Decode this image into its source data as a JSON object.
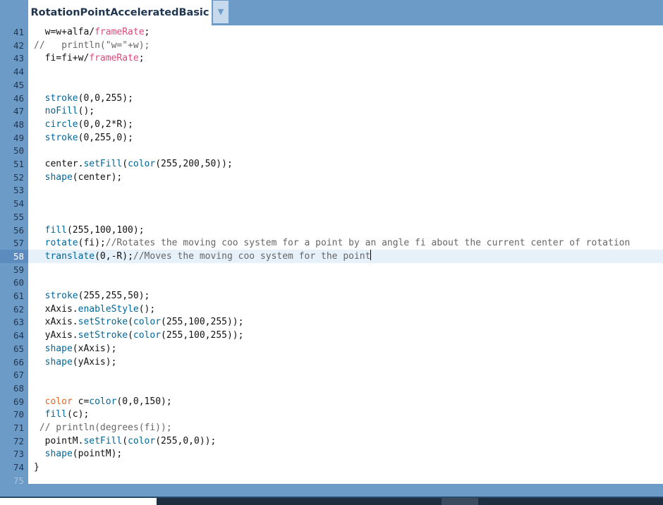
{
  "tab": {
    "title": "RotationPointAcceleratedBasic",
    "menu_arrow": "▼"
  },
  "current_line": 58,
  "lines": [
    {
      "n": "41",
      "t": [
        {
          "x": "  w=w+alfa/"
        },
        {
          "x": "frameRate",
          "c": "va"
        },
        {
          "x": ";"
        }
      ]
    },
    {
      "n": "42",
      "t": [
        {
          "x": "//   println(\"w=\"+w);",
          "c": "cm"
        }
      ]
    },
    {
      "n": "43",
      "t": [
        {
          "x": "  fi=fi+w/"
        },
        {
          "x": "frameRate",
          "c": "va"
        },
        {
          "x": ";"
        }
      ]
    },
    {
      "n": "44",
      "t": []
    },
    {
      "n": "45",
      "t": []
    },
    {
      "n": "46",
      "t": [
        {
          "x": "  "
        },
        {
          "x": "stroke",
          "c": "fn"
        },
        {
          "x": "(0,0,255);"
        }
      ]
    },
    {
      "n": "47",
      "t": [
        {
          "x": "  "
        },
        {
          "x": "noFill",
          "c": "fn"
        },
        {
          "x": "();"
        }
      ]
    },
    {
      "n": "48",
      "t": [
        {
          "x": "  "
        },
        {
          "x": "circle",
          "c": "fn"
        },
        {
          "x": "(0,0,2*R);"
        }
      ]
    },
    {
      "n": "49",
      "t": [
        {
          "x": "  "
        },
        {
          "x": "stroke",
          "c": "fn"
        },
        {
          "x": "(0,255,0);"
        }
      ]
    },
    {
      "n": "50",
      "t": []
    },
    {
      "n": "51",
      "t": [
        {
          "x": "  center."
        },
        {
          "x": "setFill",
          "c": "fn"
        },
        {
          "x": "("
        },
        {
          "x": "color",
          "c": "fn"
        },
        {
          "x": "(255,200,50));"
        }
      ]
    },
    {
      "n": "52",
      "t": [
        {
          "x": "  "
        },
        {
          "x": "shape",
          "c": "fn"
        },
        {
          "x": "(center);"
        }
      ]
    },
    {
      "n": "53",
      "t": []
    },
    {
      "n": "54",
      "t": []
    },
    {
      "n": "55",
      "t": []
    },
    {
      "n": "56",
      "t": [
        {
          "x": "  "
        },
        {
          "x": "fill",
          "c": "fn"
        },
        {
          "x": "(255,100,100);"
        }
      ]
    },
    {
      "n": "57",
      "t": [
        {
          "x": "  "
        },
        {
          "x": "rotate",
          "c": "fn"
        },
        {
          "x": "(fi);"
        },
        {
          "x": "//Rotates the moving coo system for a point by an angle fi about the current center of rotation",
          "c": "cm"
        }
      ]
    },
    {
      "n": "58",
      "t": [
        {
          "x": "  "
        },
        {
          "x": "translate",
          "c": "fn"
        },
        {
          "x": "(0,-R);"
        },
        {
          "x": "//Moves the moving coo system for the point",
          "c": "cm"
        }
      ]
    },
    {
      "n": "59",
      "t": []
    },
    {
      "n": "60",
      "t": []
    },
    {
      "n": "61",
      "t": [
        {
          "x": "  "
        },
        {
          "x": "stroke",
          "c": "fn"
        },
        {
          "x": "(255,255,50);"
        }
      ]
    },
    {
      "n": "62",
      "t": [
        {
          "x": "  xAxis."
        },
        {
          "x": "enableStyle",
          "c": "fn"
        },
        {
          "x": "();"
        }
      ]
    },
    {
      "n": "63",
      "t": [
        {
          "x": "  xAxis."
        },
        {
          "x": "setStroke",
          "c": "fn"
        },
        {
          "x": "("
        },
        {
          "x": "color",
          "c": "fn"
        },
        {
          "x": "(255,100,255));"
        }
      ]
    },
    {
      "n": "64",
      "t": [
        {
          "x": "  yAxis."
        },
        {
          "x": "setStroke",
          "c": "fn"
        },
        {
          "x": "("
        },
        {
          "x": "color",
          "c": "fn"
        },
        {
          "x": "(255,100,255));"
        }
      ]
    },
    {
      "n": "65",
      "t": [
        {
          "x": "  "
        },
        {
          "x": "shape",
          "c": "fn"
        },
        {
          "x": "(xAxis);"
        }
      ]
    },
    {
      "n": "66",
      "t": [
        {
          "x": "  "
        },
        {
          "x": "shape",
          "c": "fn"
        },
        {
          "x": "(yAxis);"
        }
      ]
    },
    {
      "n": "67",
      "t": []
    },
    {
      "n": "68",
      "t": []
    },
    {
      "n": "69",
      "t": [
        {
          "x": "  "
        },
        {
          "x": "color",
          "c": "ty"
        },
        {
          "x": " c="
        },
        {
          "x": "color",
          "c": "fn"
        },
        {
          "x": "(0,0,150);"
        }
      ]
    },
    {
      "n": "70",
      "t": [
        {
          "x": "  "
        },
        {
          "x": "fill",
          "c": "fn"
        },
        {
          "x": "(c);"
        }
      ]
    },
    {
      "n": "71",
      "t": [
        {
          "x": " // println(degrees(fi));",
          "c": "cm"
        }
      ]
    },
    {
      "n": "72",
      "t": [
        {
          "x": "  pointM."
        },
        {
          "x": "setFill",
          "c": "fn"
        },
        {
          "x": "("
        },
        {
          "x": "color",
          "c": "fn"
        },
        {
          "x": "(255,0,0));"
        }
      ]
    },
    {
      "n": "73",
      "t": [
        {
          "x": "  "
        },
        {
          "x": "shape",
          "c": "fn"
        },
        {
          "x": "(pointM);"
        }
      ]
    },
    {
      "n": "74",
      "t": [
        {
          "x": "}"
        }
      ]
    },
    {
      "n": "75",
      "t": []
    }
  ],
  "colors": {
    "chrome": "#6c9bc8",
    "current_line": "#e7f1f9",
    "function": "#006699",
    "variable": "#d94a7a",
    "type": "#e2661a",
    "comment": "#666666"
  }
}
